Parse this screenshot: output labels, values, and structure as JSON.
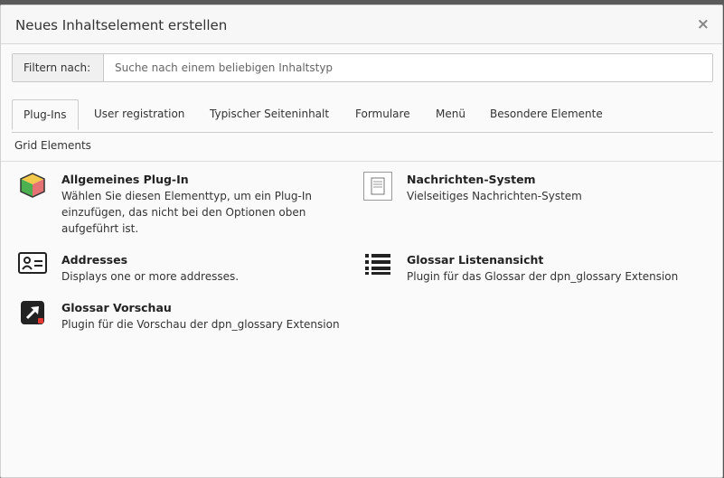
{
  "modal": {
    "title": "Neues Inhaltselement erstellen",
    "close_symbol": "×"
  },
  "filter": {
    "label": "Filtern nach:",
    "placeholder": "Suche nach einem beliebigen Inhaltstyp",
    "value": ""
  },
  "tabs": [
    {
      "label": "Plug-Ins",
      "active": true
    },
    {
      "label": "User registration"
    },
    {
      "label": "Typischer Seiteninhalt"
    },
    {
      "label": "Formulare"
    },
    {
      "label": "Menü"
    },
    {
      "label": "Besondere Elemente"
    },
    {
      "label": "Grid Elements"
    }
  ],
  "items": [
    {
      "title": "Allgemeines Plug-In",
      "desc1": "Wählen Sie diesen Elementtyp, um ein Plug-In",
      "desc2": "einzufügen, das nicht bei den Optionen oben",
      "desc3": "aufgeführt ist.",
      "icon": "plugin-cube-icon"
    },
    {
      "title": "Nachrichten-System",
      "desc1": "Vielseitiges Nachrichten-System",
      "icon": "news-document-icon"
    },
    {
      "title": "Addresses",
      "desc1": "Displays one or more addresses.",
      "icon": "address-card-icon"
    },
    {
      "title": "Glossar Listenansicht",
      "desc1": "Plugin für das Glossar der dpn_glossary Extension",
      "icon": "list-icon"
    },
    {
      "title": "Glossar Vorschau",
      "desc1": "Plugin für die Vorschau der dpn_glossary Extension",
      "icon": "external-link-icon"
    }
  ]
}
